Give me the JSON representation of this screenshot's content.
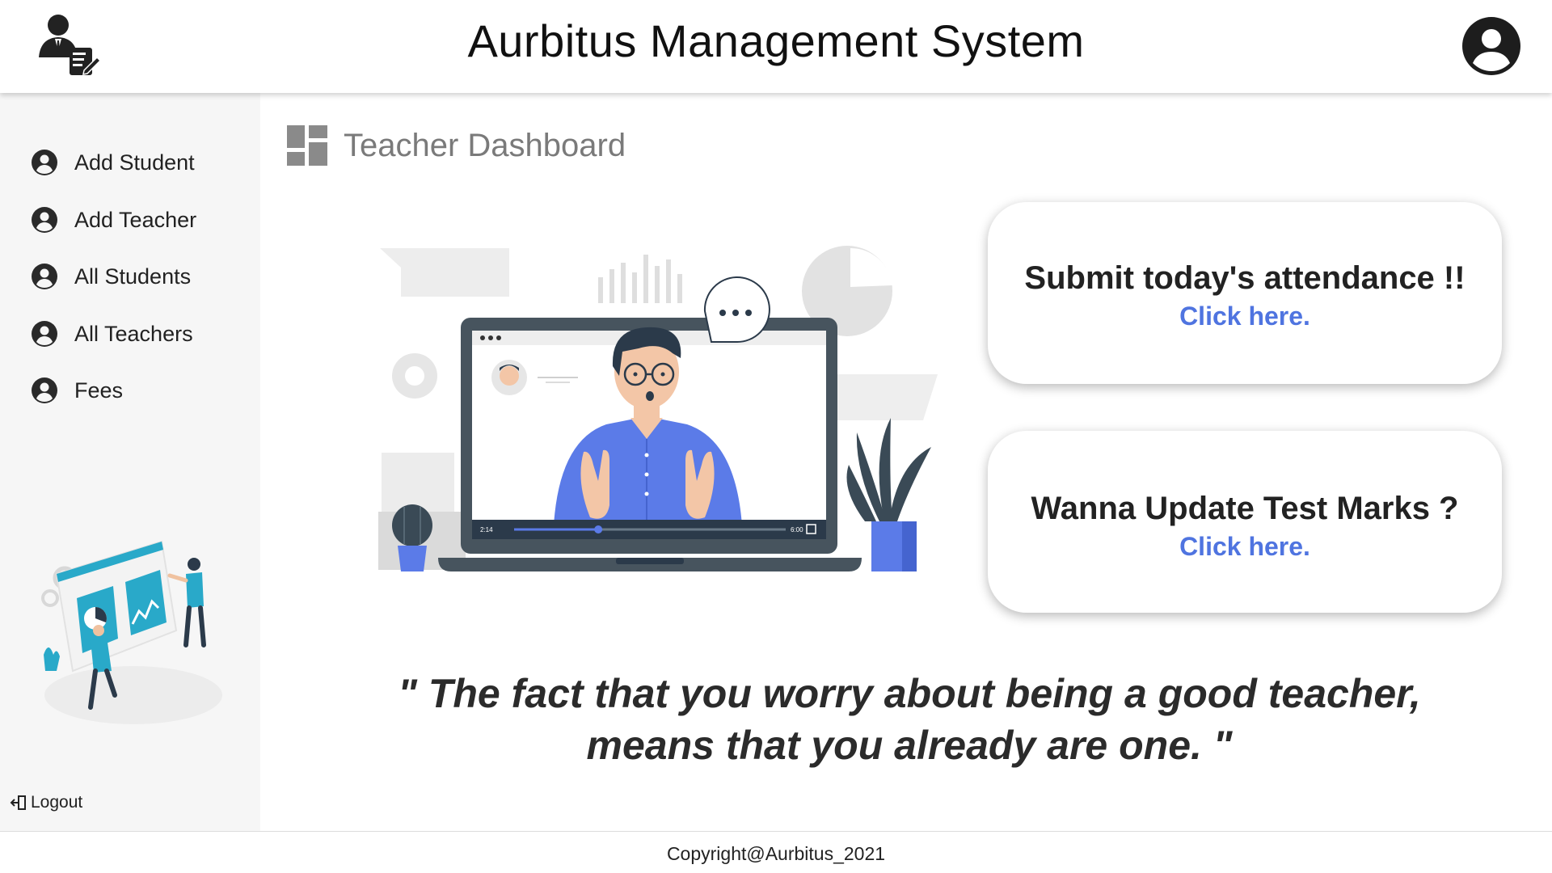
{
  "header": {
    "title": "Aurbitus Management System",
    "logo_icon": "teacher-document-icon",
    "account_icon": "user-circle-icon"
  },
  "sidebar": {
    "items": [
      {
        "label": "Add Student",
        "icon": "user-circle-icon"
      },
      {
        "label": "Add Teacher",
        "icon": "user-circle-icon"
      },
      {
        "label": "All Students",
        "icon": "user-circle-icon"
      },
      {
        "label": "All Teachers",
        "icon": "user-circle-icon"
      },
      {
        "label": "Fees",
        "icon": "user-circle-icon"
      }
    ],
    "logout_label": "Logout"
  },
  "main": {
    "title": "Teacher Dashboard",
    "title_icon": "dashboard-icon",
    "video_time_current": "2:14",
    "video_time_total": "6:00",
    "video_progress": 0.31,
    "cards": [
      {
        "title": "Submit today's attendance !!",
        "link": "Click here."
      },
      {
        "title": "Wanna Update Test Marks ?",
        "link": "Click here."
      }
    ],
    "quote_line1": "\" The fact that you worry about being a good teacher,",
    "quote_line2": "means that you already are one. \""
  },
  "footer": {
    "copyright": "Copyright@Aurbitus_2021"
  },
  "colors": {
    "accent_blue": "#4f74e0",
    "illustration_blue": "#5b7be8",
    "illustration_cyan": "#29a9c9",
    "sidebar_bg": "#f6f6f6"
  }
}
